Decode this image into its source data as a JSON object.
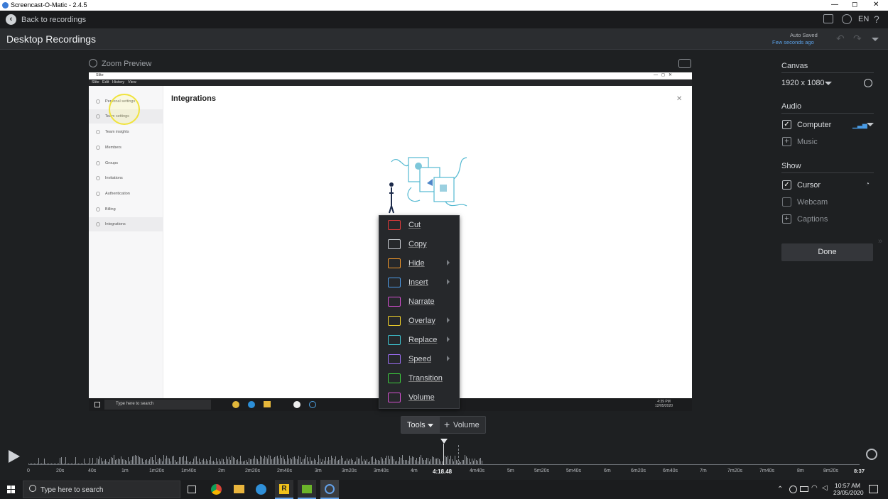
{
  "window": {
    "title": "Screencast-O-Matic - 2.4.5",
    "min": "—",
    "max": "◻",
    "close": "✕"
  },
  "nav": {
    "back_label": "Back to recordings",
    "lang": "EN",
    "help": "?"
  },
  "header": {
    "title": "Desktop Recordings",
    "auto_saved": "Auto Saved",
    "saved_when": "Few seconds ago"
  },
  "preview": {
    "zoom_label": "Zoom Preview",
    "inner_app": {
      "title": "Slite",
      "menu": [
        "Slite",
        "Edit",
        "History",
        "View"
      ],
      "sidebar": [
        "Personal settings",
        "Team settings",
        "Team insights",
        "Members",
        "Groups",
        "Invitations",
        "Authentication",
        "Billing",
        "Integrations"
      ],
      "panel_title": "Integrations",
      "taskbar_search": "Type here to search",
      "clock_time": "4:39 PM",
      "clock_date": "12/05/2020"
    }
  },
  "context_menu": {
    "items": [
      {
        "label": "Cut",
        "color": "#e03a3a",
        "submenu": false
      },
      {
        "label": "Copy",
        "color": "#c8cbd0",
        "submenu": false
      },
      {
        "label": "Hide",
        "color": "#f0962a",
        "submenu": true
      },
      {
        "label": "Insert",
        "color": "#4c9be8",
        "submenu": true
      },
      {
        "label": "Narrate",
        "color": "#d34fd0",
        "submenu": false
      },
      {
        "label": "Overlay",
        "color": "#f2d22a",
        "submenu": true
      },
      {
        "label": "Replace",
        "color": "#3ec3d0",
        "submenu": true
      },
      {
        "label": "Speed",
        "color": "#9a6cf0",
        "submenu": true
      },
      {
        "label": "Transition",
        "color": "#3ccc3c",
        "submenu": false
      },
      {
        "label": "Volume",
        "color": "#d34fd0",
        "submenu": false
      }
    ]
  },
  "tools": {
    "tools_label": "Tools",
    "volume_label": "Volume"
  },
  "right": {
    "canvas_label": "Canvas",
    "resolution": "1920 x 1080",
    "audio_label": "Audio",
    "computer_label": "Computer",
    "music_label": "Music",
    "show_label": "Show",
    "cursor_label": "Cursor",
    "webcam_label": "Webcam",
    "captions_label": "Captions",
    "done_label": "Done"
  },
  "timeline": {
    "current": "4:18.48",
    "end": "8:37",
    "ticks": [
      "0",
      "20s",
      "40s",
      "1m",
      "1m20s",
      "1m40s",
      "2m",
      "2m20s",
      "2m40s",
      "3m",
      "3m20s",
      "3m40s",
      "4m",
      "4m40s",
      "5m",
      "5m20s",
      "5m40s",
      "6m",
      "6m20s",
      "6m40s",
      "7m",
      "7m20s",
      "7m40s",
      "8m",
      "8m20s"
    ]
  },
  "taskbar": {
    "search": "Type here to search",
    "time": "10:57 AM",
    "date": "23/05/2020"
  }
}
